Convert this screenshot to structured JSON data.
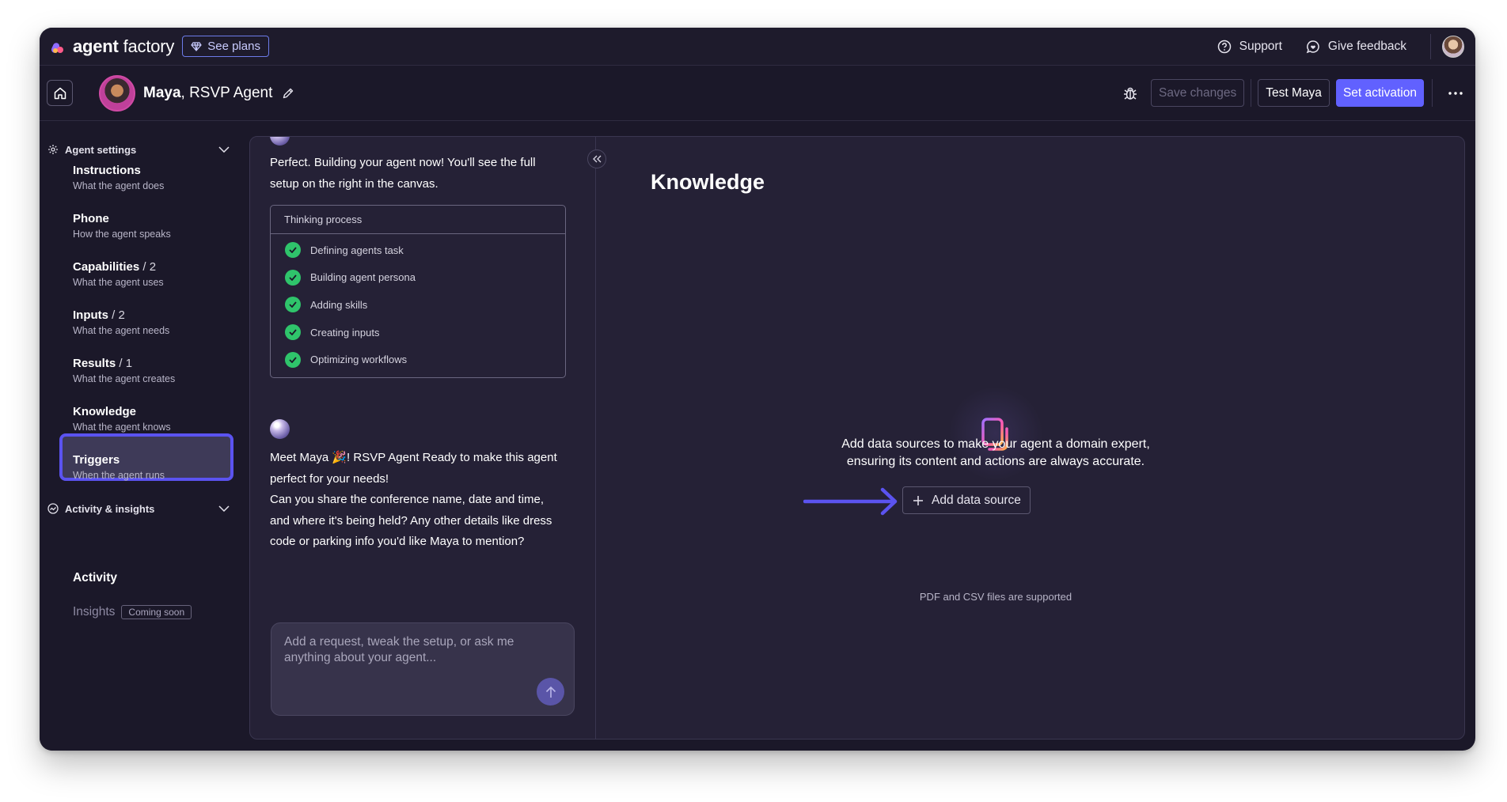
{
  "topbar": {
    "brand_bold": "agent",
    "brand_light": "factory",
    "see_plans": "See plans",
    "support": "Support",
    "give_feedback": "Give feedback"
  },
  "header": {
    "agent_first": "Maya",
    "agent_rest": ", RSVP Agent",
    "save_changes": "Save changes",
    "test_agent": "Test Maya",
    "set_activation": "Set activation"
  },
  "sidebar": {
    "agent_settings": "Agent settings",
    "items": [
      {
        "title": "Instructions",
        "count": "",
        "sub": "What the agent does"
      },
      {
        "title": "Phone",
        "count": "",
        "sub": "How the agent speaks"
      },
      {
        "title": "Capabilities",
        "count": "/ 2",
        "sub": "What the agent uses"
      },
      {
        "title": "Inputs",
        "count": "/ 2",
        "sub": "What the agent needs"
      },
      {
        "title": "Results",
        "count": "/ 1",
        "sub": "What the agent creates"
      },
      {
        "title": "Knowledge",
        "count": "",
        "sub": "What the agent knows"
      },
      {
        "title": "Triggers",
        "count": "",
        "sub": "When the agent runs"
      }
    ],
    "activity_insights": "Activity & insights",
    "activity": "Activity",
    "insights": "Insights",
    "coming_soon": "Coming soon"
  },
  "chat": {
    "msg1": "Perfect. Building your agent now! You'll see the full setup on the right in the canvas.",
    "thinking_title": "Thinking process",
    "steps": [
      "Defining agents task",
      "Building agent persona",
      "Adding skills",
      "Creating inputs",
      "Optimizing workflows"
    ],
    "msg2": "Meet Maya 🎉! RSVP Agent Ready to make this agent perfect for your needs!",
    "msg3": "Can you share the conference name, date and time, and where it's being held? Any other details like dress code or parking info you'd like Maya to mention?",
    "input_placeholder": "Add a request, tweak the setup, or ask me anything about your agent..."
  },
  "canvas": {
    "title": "Knowledge",
    "empty_line1": "Add data sources to make your agent a domain expert,",
    "empty_line2": "ensuring its content and actions are always accurate.",
    "add_source": "Add data source",
    "note": "PDF and CSV files are supported"
  },
  "colors": {
    "accent": "#6161ff",
    "success": "#2fc46b",
    "highlight": "#5b53f0"
  }
}
